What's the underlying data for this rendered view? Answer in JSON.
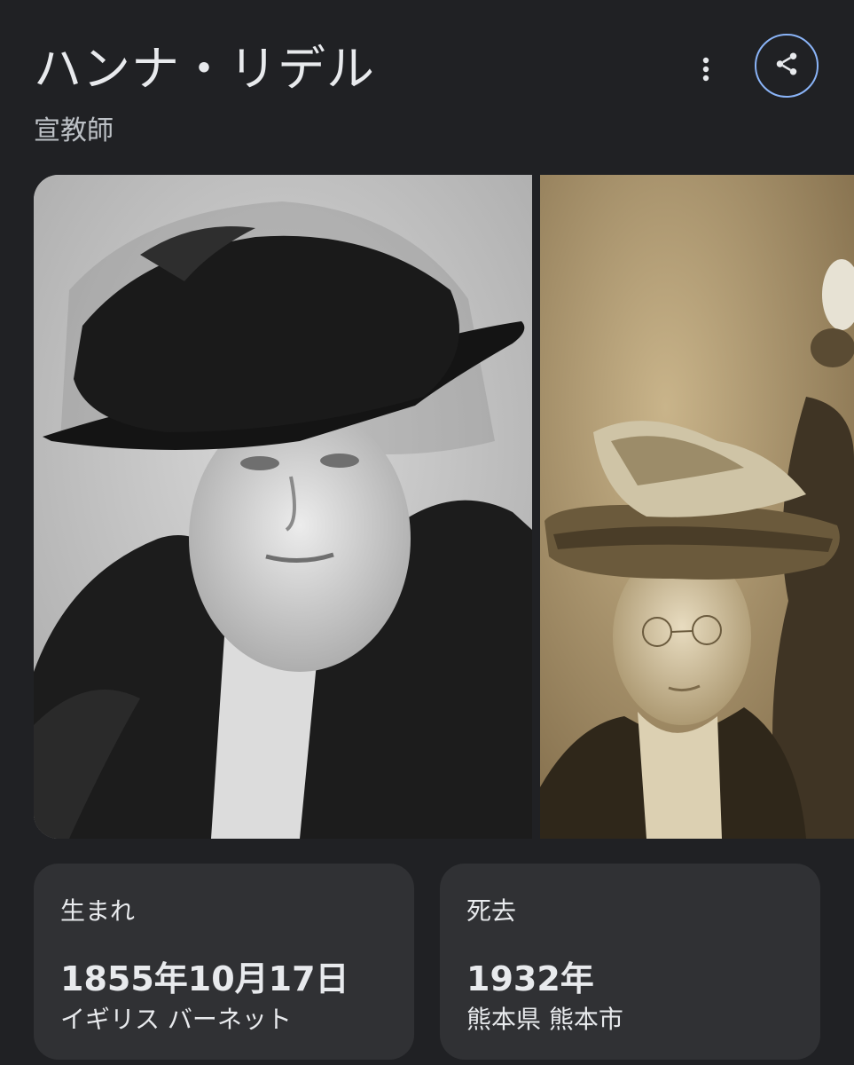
{
  "header": {
    "title": "ハンナ・リデル",
    "subtitle": "宣教師",
    "more_icon": "more-vert-icon",
    "share_icon": "share-icon",
    "accent_color": "#8ab4f8"
  },
  "gallery": {
    "photos": [
      {
        "tone": "black-and-white"
      },
      {
        "tone": "sepia"
      }
    ]
  },
  "facts": {
    "born": {
      "label": "生まれ",
      "date": "1855年10月17日",
      "place": "イギリス バーネット"
    },
    "died": {
      "label": "死去",
      "date": "1932年",
      "place": "熊本県 熊本市"
    }
  }
}
